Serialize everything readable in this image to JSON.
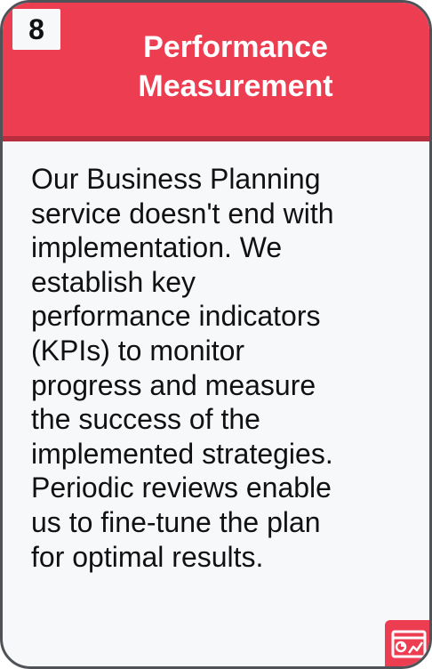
{
  "card": {
    "number": "8",
    "title_lines": [
      "Performance",
      "Measurement"
    ],
    "body_lines": [
      "Our Business Planning",
      "service doesn't end with",
      "implementation. We",
      "establish key",
      "performance indicators",
      "(KPIs) to monitor",
      "progress and measure",
      "the success of the",
      "implemented strategies.",
      "Periodic reviews enable",
      "us to fine-tune the plan",
      "for optimal results."
    ],
    "icon": "report-chart-icon"
  },
  "colors": {
    "accent": "#ec3d51",
    "accent_dark": "#b92e3e",
    "card_background": "#f6f8fa",
    "border": "#4f5358",
    "text": "#111111"
  }
}
